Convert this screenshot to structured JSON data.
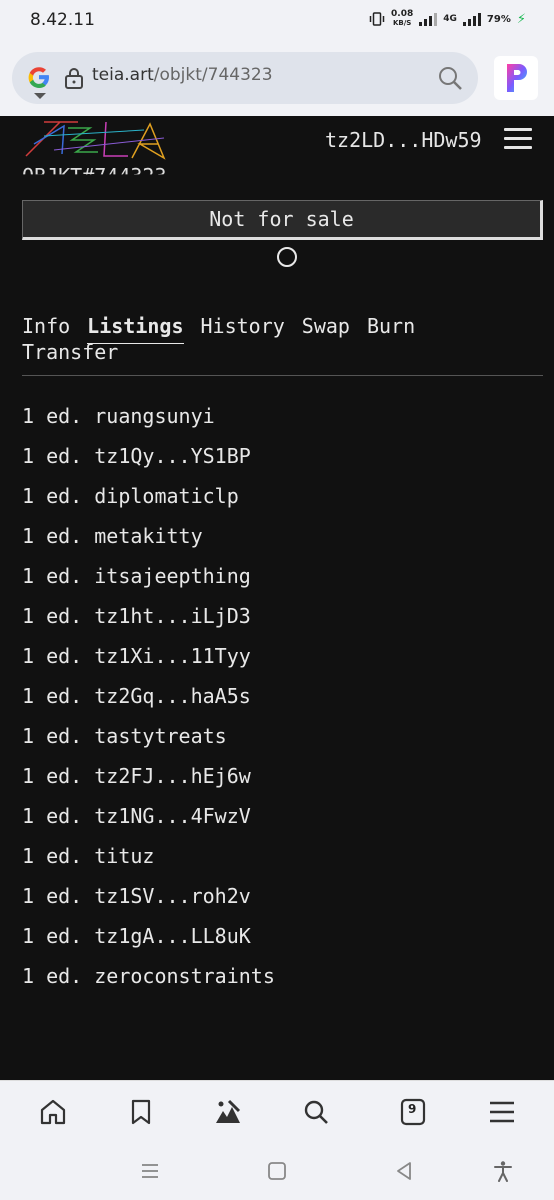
{
  "status_bar": {
    "time": "8.42.11",
    "net_speed_value": "0.08",
    "net_speed_unit": "KB/S",
    "network_type": "4G",
    "battery": "79%"
  },
  "browser": {
    "url_domain": "teia.art",
    "url_path": "/objkt/744323",
    "open_tabs": "9"
  },
  "header": {
    "logo_text": "TEIA",
    "wallet": "tz2LD...HDw59"
  },
  "objkt": {
    "title_partial": "OBJKT#744323",
    "sale_button": "Not for sale"
  },
  "tabs": [
    {
      "label": "Info",
      "active": false
    },
    {
      "label": "Listings",
      "active": true
    },
    {
      "label": "History",
      "active": false
    },
    {
      "label": "Swap",
      "active": false
    },
    {
      "label": "Burn",
      "active": false
    },
    {
      "label": "Transfer",
      "active": false
    }
  ],
  "listings": [
    {
      "editions": "1 ed.",
      "holder": "ruangsunyi"
    },
    {
      "editions": "1 ed.",
      "holder": "tz1Qy...YS1BP"
    },
    {
      "editions": "1 ed.",
      "holder": "diplomaticlp"
    },
    {
      "editions": "1 ed.",
      "holder": "metakitty"
    },
    {
      "editions": "1 ed.",
      "holder": "itsajeepthing"
    },
    {
      "editions": "1 ed.",
      "holder": "tz1ht...iLjD3"
    },
    {
      "editions": "1 ed.",
      "holder": "tz1Xi...11Tyy"
    },
    {
      "editions": "1 ed.",
      "holder": "tz2Gq...haA5s"
    },
    {
      "editions": "1 ed.",
      "holder": "tastytreats"
    },
    {
      "editions": "1 ed.",
      "holder": "tz2FJ...hEj6w"
    },
    {
      "editions": "1 ed.",
      "holder": "tz1NG...4FwzV"
    },
    {
      "editions": "1 ed.",
      "holder": "tituz"
    },
    {
      "editions": "1 ed.",
      "holder": "tz1SV...roh2v"
    },
    {
      "editions": "1 ed.",
      "holder": "tz1gA...LL8uK"
    },
    {
      "editions": "1 ed.",
      "holder": "zeroconstraints"
    }
  ],
  "icons": {
    "bottom_nav": [
      "home-icon",
      "bookmark-icon",
      "art-icon",
      "search-icon",
      "tabs-icon",
      "menu-icon"
    ],
    "system_nav": [
      "recents-icon",
      "home-square-icon",
      "back-icon",
      "accessibility-icon"
    ]
  },
  "colors": {
    "page_bg": "#111111",
    "text": "#e8e8e8",
    "browser_chrome": "#f1f2f6"
  }
}
